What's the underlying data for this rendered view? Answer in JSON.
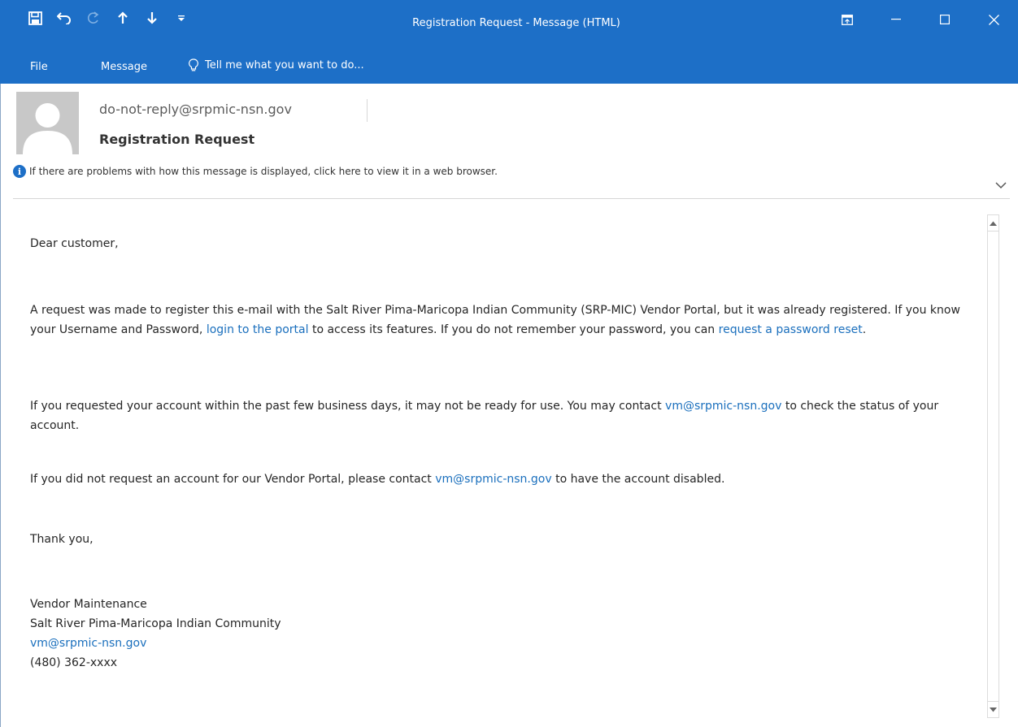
{
  "window": {
    "title": "Registration Request - Message (HTML)",
    "accent_color": "#1d6fc7"
  },
  "quick_access": {
    "icons": [
      "save-icon",
      "undo-icon",
      "redo-icon",
      "previous-item-icon",
      "next-item-icon",
      "customize-toolbar-icon"
    ]
  },
  "ribbon": {
    "tabs": [
      {
        "label": "File"
      },
      {
        "label": "Message"
      }
    ],
    "tell_me": "Tell me what you want to do..."
  },
  "header": {
    "sender": "do-not-reply@srpmic-nsn.gov",
    "subject": "Registration Request",
    "info_bar": "If there are problems with how this message is displayed, click here to view it in a web browser."
  },
  "body": {
    "greeting": "Dear customer,",
    "p1_a": "A request was made to register this e-mail with the Salt River Pima-Maricopa Indian Community (SRP-MIC) Vendor Portal, but it was already registered. If you know your Username and Password, ",
    "p1_link1": "login to the portal",
    "p1_b": " to access its features. If you do not remember your password, you can ",
    "p1_link2": "request a password reset",
    "p1_c": ".",
    "p2_a": "If you requested your account within the past few business days, it may not be ready for use. You may contact ",
    "p2_link": "vm@srpmic-nsn.gov",
    "p2_b": " to check the status of your account.",
    "p3_a": "If you did not request an account for our Vendor Portal, please contact ",
    "p3_link": "vm@srpmic-nsn.gov",
    "p3_b": " to have the account disabled.",
    "thanks": "Thank you,",
    "signature": {
      "name": "Vendor Maintenance",
      "org": "Salt River Pima-Maricopa Indian Community",
      "email": "vm@srpmic-nsn.gov",
      "phone": "(480) 362-xxxx"
    },
    "link_color": "#1a6fbd"
  }
}
